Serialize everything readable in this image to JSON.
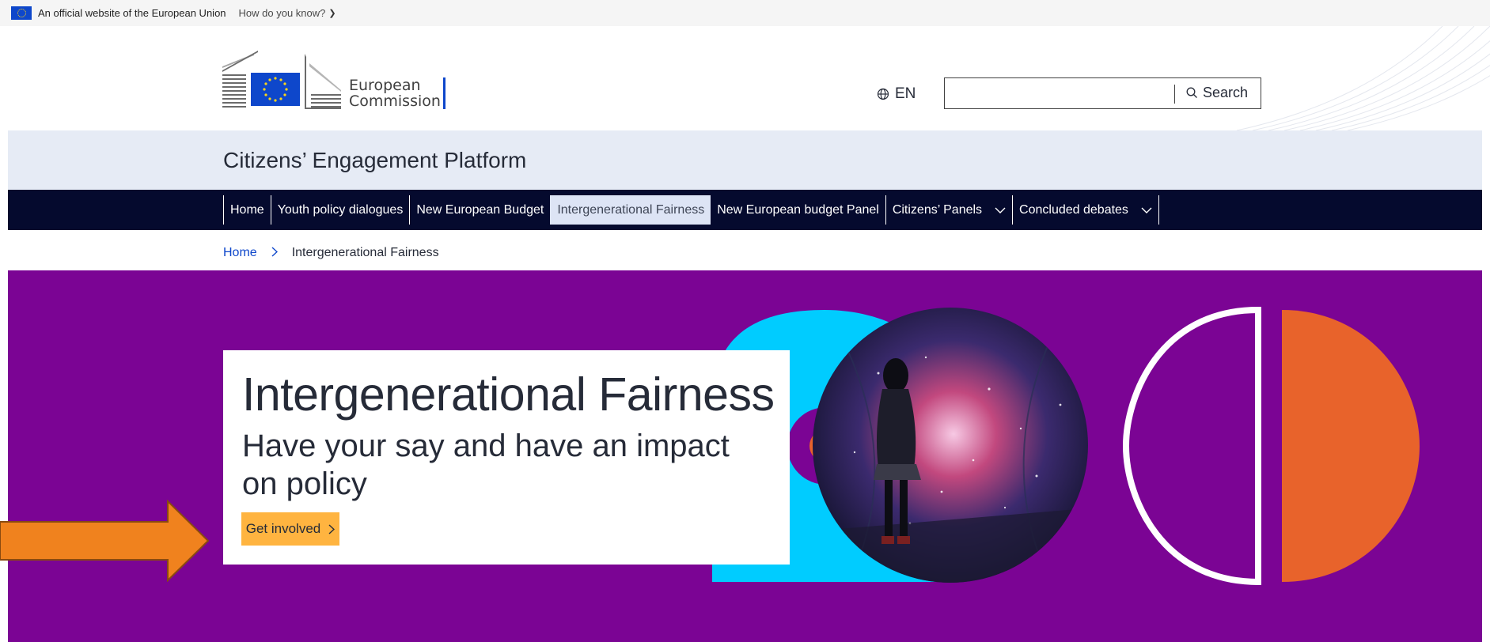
{
  "gov_bar": {
    "official_text": "An official website of the European Union",
    "how_text": "How do you know?",
    "flag_icon": "eu-flag-icon",
    "chevron_icon": "chevron-down-icon"
  },
  "header": {
    "logo_line1": "European",
    "logo_line2": "Commission",
    "language": "EN",
    "language_icon": "globe-icon",
    "search_value": "",
    "search_label": "Search",
    "search_icon": "search-icon"
  },
  "platform": {
    "title": "Citizens’ Engagement Platform"
  },
  "nav": {
    "items": [
      {
        "label": "Home"
      },
      {
        "label": "Youth policy dialogues"
      },
      {
        "label": "New European Budget"
      },
      {
        "label": "Intergenerational Fairness",
        "active": true
      },
      {
        "label": "New European budget Panel"
      },
      {
        "label": "Citizens’ Panels",
        "dropdown": true
      },
      {
        "label": "Concluded debates",
        "dropdown": true
      }
    ]
  },
  "breadcrumb": {
    "home": "Home",
    "separator_icon": "chevron-right-icon",
    "current": "Intergenerational Fairness"
  },
  "hero": {
    "title": "Intergenerational Fairness",
    "subtitle": "Have your say and have an impact on policy",
    "cta_label": "Get involved",
    "cta_icon": "chevron-right-icon"
  },
  "colors": {
    "hero_background": "#7b0494",
    "nav_background": "#050a2e",
    "platform_bar": "#e6ebf5",
    "cta": "#ffb440",
    "accent_cyan": "#00ccff",
    "accent_orange": "#e8632b",
    "eu_blue": "#0e47cb"
  }
}
